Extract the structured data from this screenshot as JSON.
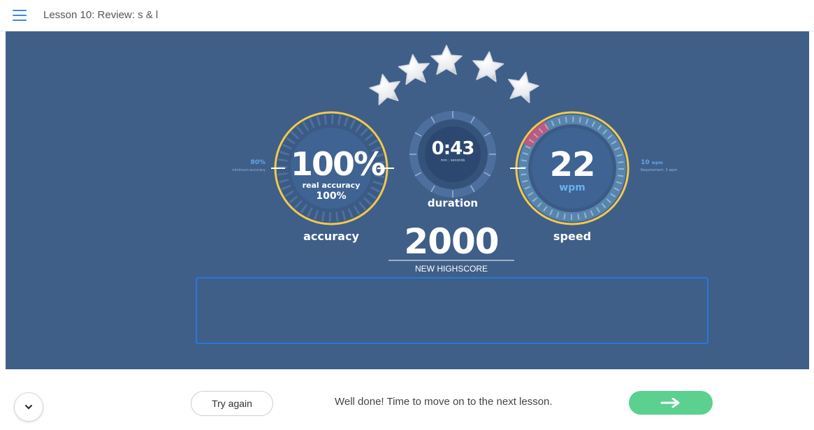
{
  "header": {
    "lesson_title": "Lesson 10: Review: s & l"
  },
  "stars": {
    "earned": 5,
    "total": 5
  },
  "accuracy": {
    "value": "100%",
    "sub_label": "real accuracy",
    "sub_value": "100%",
    "label": "accuracy",
    "min_value": "80%",
    "min_label": "minimum accuracy"
  },
  "duration": {
    "value": "0:43",
    "unit": "min : seconds",
    "label": "duration"
  },
  "speed": {
    "value": "22",
    "unit": "wpm",
    "label": "speed",
    "req_value": "10",
    "req_unit": "wpm",
    "req_label": "Requirement: 3 wpm"
  },
  "score": {
    "value": "2000",
    "label": "NEW HIGHSCORE"
  },
  "footer": {
    "try_again_label": "Try again",
    "message": "Well done! Time to move on to the next lesson."
  },
  "colors": {
    "panel": "#3f5f89",
    "gold": "#f2c94c",
    "accent_green": "#5bd08f",
    "speed_red": "#c8557a"
  },
  "icons": [
    "menu-icon",
    "star-icon",
    "chevron-down-icon",
    "arrow-right-icon"
  ]
}
